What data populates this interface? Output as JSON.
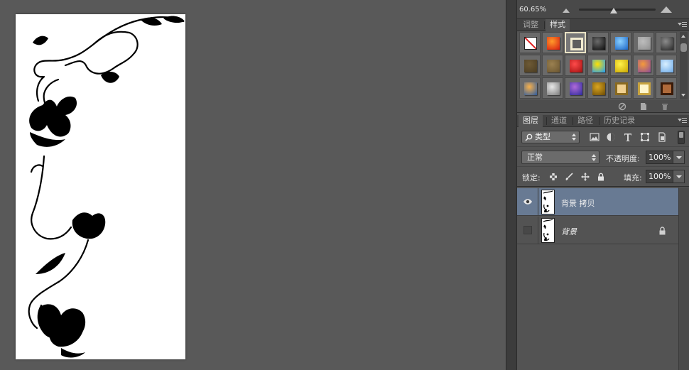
{
  "navigator": {
    "zoom": "60.65%",
    "zoom_level": 0.43
  },
  "styles_panel": {
    "tabs": [
      {
        "label": "调整",
        "active": false
      },
      {
        "label": "样式",
        "active": true
      }
    ],
    "swatches": [
      {
        "name": "none-style",
        "colors": [
          "#ffffff",
          "#e02020"
        ]
      },
      {
        "name": "red-glow",
        "colors": [
          "#ff9a2a",
          "#d61a10"
        ]
      },
      {
        "name": "outline-frame",
        "colors": [
          "#5e5e5e",
          "#f2ecd0"
        ]
      },
      {
        "name": "black-button",
        "colors": [
          "#6b6b6b",
          "#0d0d0d"
        ]
      },
      {
        "name": "blue-glass",
        "colors": [
          "#8ad0ff",
          "#1b64c4"
        ]
      },
      {
        "name": "gray-flat",
        "colors": [
          "#bdbdbd",
          "#8f8f8f"
        ]
      },
      {
        "name": "dark-metal",
        "colors": [
          "#8c8c8c",
          "#2a2a2a"
        ]
      },
      {
        "name": "brown-matte",
        "colors": [
          "#6e5a35",
          "#4a3c22"
        ]
      },
      {
        "name": "khaki",
        "colors": [
          "#9a8050",
          "#6a5530"
        ]
      },
      {
        "name": "red-button",
        "colors": [
          "#ff4a4a",
          "#a00f0f"
        ]
      },
      {
        "name": "rainbow",
        "colors": [
          "#ffe100",
          "#1a9cff"
        ]
      },
      {
        "name": "yellow-gloss",
        "colors": [
          "#fff24a",
          "#c9a500"
        ]
      },
      {
        "name": "orange-purple",
        "colors": [
          "#f59a3a",
          "#8a4a9a"
        ]
      },
      {
        "name": "sky-blue",
        "colors": [
          "#d8efff",
          "#6aa8e8"
        ]
      },
      {
        "name": "sunset-water",
        "colors": [
          "#f7b04a",
          "#2a5aa0"
        ]
      },
      {
        "name": "mosaic",
        "colors": [
          "#e8e8e8",
          "#7a7a7a"
        ]
      },
      {
        "name": "violet",
        "colors": [
          "#b06ad8",
          "#2a2a9a"
        ]
      },
      {
        "name": "gold-texture",
        "colors": [
          "#d9a520",
          "#6b4a05"
        ]
      },
      {
        "name": "gold-frame",
        "colors": [
          "#f0d090",
          "#8a6a20"
        ]
      },
      {
        "name": "cream-frame",
        "colors": [
          "#fff6cc",
          "#c8a440"
        ]
      },
      {
        "name": "wood-frame",
        "colors": [
          "#b06a3a",
          "#3a1a08"
        ]
      }
    ]
  },
  "layers_panel": {
    "tabs": [
      {
        "label": "图层",
        "active": true
      },
      {
        "label": "通道",
        "active": false
      },
      {
        "label": "路径",
        "active": false
      },
      {
        "label": "历史记录",
        "active": false
      }
    ],
    "filter_kind": "类型",
    "blend_mode": "正常",
    "opacity_label": "不透明度:",
    "opacity": "100%",
    "lock_label": "锁定:",
    "fill_label": "填充:",
    "fill": "100%",
    "layers": [
      {
        "name": "背景 拷贝",
        "visible": true,
        "selected": true,
        "locked": false
      },
      {
        "name": "背景",
        "visible": false,
        "selected": false,
        "locked": true
      }
    ]
  },
  "colors": {
    "workspace": "#595959",
    "panel": "#535353",
    "selected_layer": "#687a93"
  }
}
